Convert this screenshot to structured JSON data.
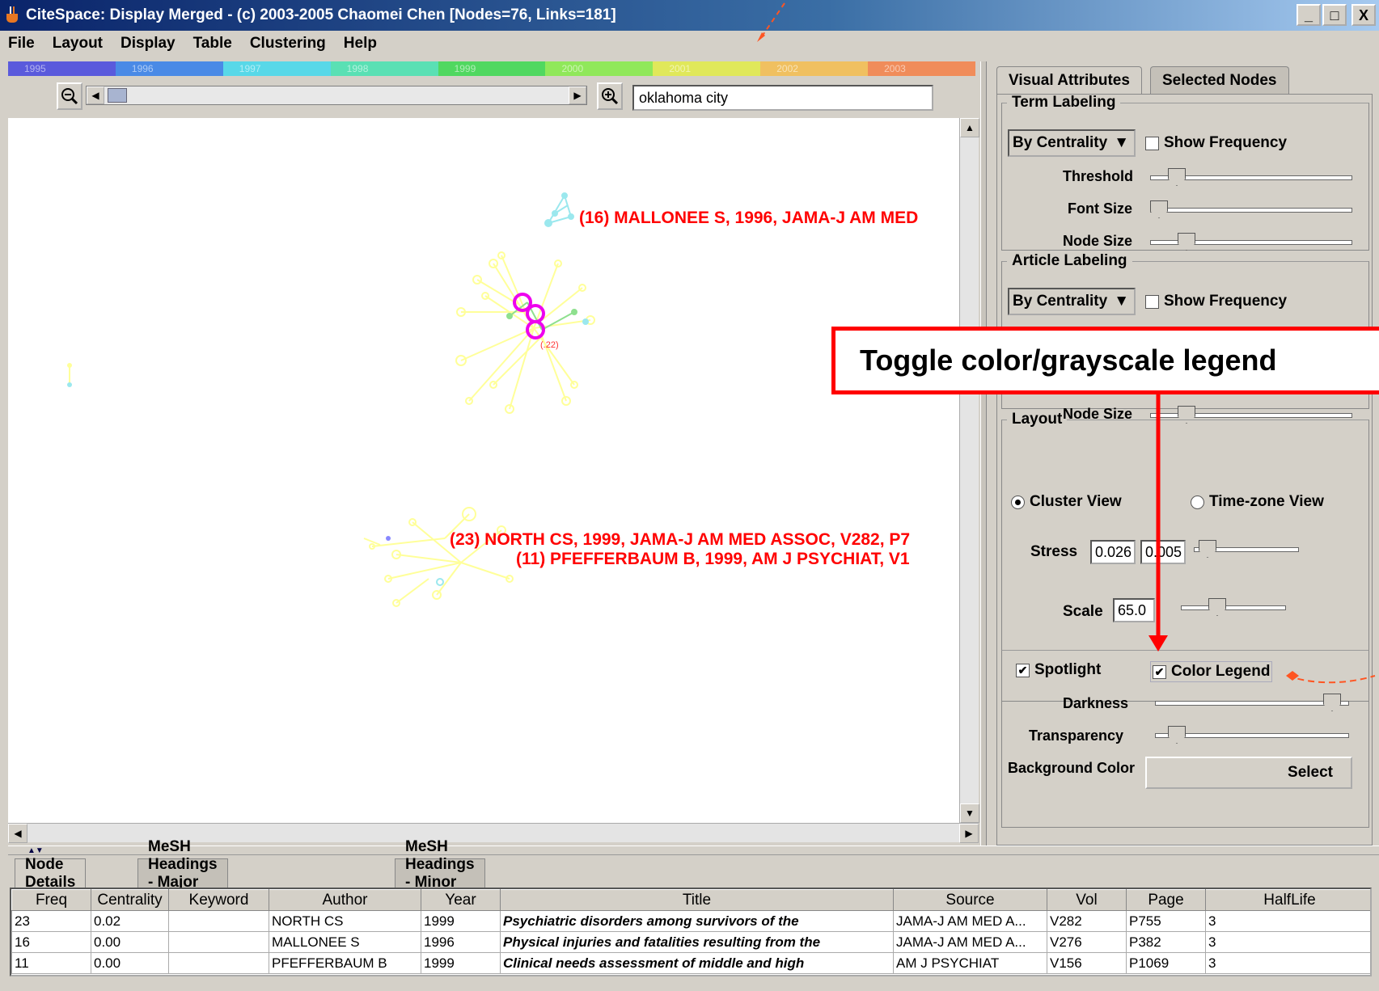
{
  "window": {
    "title": "CiteSpace: Display Merged - (c) 2003-2005 Chaomei Chen [Nodes=76, Links=181]",
    "buttons": [
      "_",
      "□",
      "X"
    ]
  },
  "menu": [
    "File",
    "Layout",
    "Display",
    "Table",
    "Clustering",
    "Help"
  ],
  "timeline": {
    "years": [
      "1995",
      "1996",
      "1997",
      "1998",
      "1999",
      "2000",
      "2001",
      "2002",
      "2003"
    ],
    "colors": [
      "#5a5adc",
      "#4a8ae6",
      "#58d8e8",
      "#5ae0b4",
      "#50d860",
      "#90e85a",
      "#e0e85a",
      "#f0c060",
      "#f08c5a"
    ]
  },
  "search": {
    "value": "oklahoma city"
  },
  "graph": {
    "labels": [
      "(16) MALLONEE S, 1996, JAMA-J AM MED",
      "(23) NORTH CS, 1999, JAMA-J AM MED ASSOC, V282, P7",
      "(11) PFEFFERBAUM B, 1999, AM J PSYCHIAT, V1",
      "(.22)"
    ]
  },
  "right_panel": {
    "tabs": [
      "Visual Attributes",
      "Selected Nodes"
    ],
    "term_labeling": {
      "title": "Term Labeling",
      "combo": "By Centrality",
      "show_frequency": "Show Frequency",
      "threshold": "Threshold",
      "font_size": "Font Size",
      "node_size": "Node Size"
    },
    "article_labeling": {
      "title": "Article Labeling",
      "combo": "By Centrality",
      "show_frequency": "Show Frequency",
      "node_size": "Node Size"
    },
    "layout": {
      "title": "Layout",
      "cluster_view": "Cluster View",
      "timezone_view": "Time-zone View",
      "stress_label": "Stress",
      "stress_value1": "0.026",
      "stress_value2": "0.005",
      "scale_label": "Scale",
      "scale_value": "65.0"
    },
    "display": {
      "spotlight": "Spotlight",
      "color_legend": "Color Legend",
      "darkness": "Darkness",
      "transparency": "Transparency",
      "background_color": "Background Color",
      "select": "Select"
    }
  },
  "callout": {
    "text": "Toggle color/grayscale legend"
  },
  "bottom": {
    "tabs": [
      "Node Details",
      "MeSH Headings - Major Topics",
      "MeSH Headings - Minor Topics"
    ],
    "columns": [
      "Freq",
      "Centrality",
      "Keyword",
      "Author",
      "Year",
      "Title",
      "Source",
      "Vol",
      "Page",
      "HalfLife"
    ],
    "rows": [
      [
        "23",
        "0.02",
        "",
        "NORTH CS",
        "1999",
        "Psychiatric disorders among survivors of the",
        "JAMA-J AM MED A...",
        "V282",
        "P755",
        "3"
      ],
      [
        "16",
        "0.00",
        "",
        "MALLONEE S",
        "1996",
        "Physical injuries and fatalities resulting from the",
        "JAMA-J AM MED A...",
        "V276",
        "P382",
        "3"
      ],
      [
        "11",
        "0.00",
        "",
        "PFEFFERBAUM B",
        "1999",
        "Clinical needs assessment of middle and high",
        "AM J PSYCHIAT",
        "V156",
        "P1069",
        "3"
      ]
    ]
  }
}
